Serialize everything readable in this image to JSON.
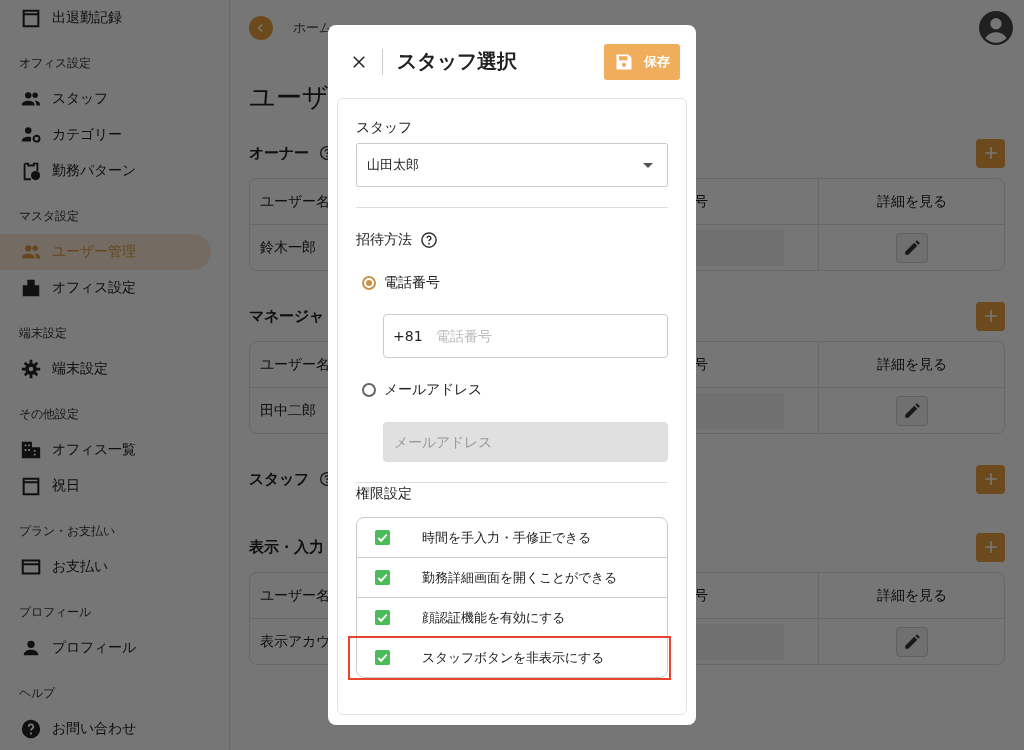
{
  "sidebar": {
    "groups": [
      {
        "items": [
          {
            "label": "出退勤記録",
            "selected": false
          }
        ]
      },
      {
        "heading": "オフィス設定",
        "items": [
          {
            "label": "スタッフ",
            "selected": false
          },
          {
            "label": "カテゴリー",
            "selected": false
          },
          {
            "label": "勤務パターン",
            "selected": false
          }
        ]
      },
      {
        "heading": "マスタ設定",
        "items": [
          {
            "label": "ユーザー管理",
            "selected": true
          },
          {
            "label": "オフィス設定",
            "selected": false
          }
        ]
      },
      {
        "heading": "端末設定",
        "items": [
          {
            "label": "端末設定",
            "selected": false
          }
        ]
      },
      {
        "heading": "その他設定",
        "items": [
          {
            "label": "オフィス一覧",
            "selected": false
          },
          {
            "label": "祝日",
            "selected": false
          }
        ]
      },
      {
        "heading": "プラン・お支払い",
        "items": [
          {
            "label": "お支払い",
            "selected": false
          }
        ]
      },
      {
        "heading": "プロフィール",
        "items": [
          {
            "label": "プロフィール",
            "selected": false
          }
        ]
      },
      {
        "heading": "ヘルプ",
        "items": [
          {
            "label": "お問い合わせ",
            "selected": false
          }
        ]
      }
    ]
  },
  "header": {
    "breadcrumb": "ホーム"
  },
  "page": {
    "title": "ユーザ",
    "sections": [
      {
        "title": "オーナー",
        "help": true,
        "table": {
          "columns": [
            "ユーザー名",
            "号",
            "詳細を見る"
          ],
          "rows": [
            {
              "name": "鈴木一郎"
            }
          ]
        }
      },
      {
        "title": "マネージャ",
        "table": {
          "columns": [
            "ユーザー名",
            "号",
            "詳細を見る"
          ],
          "rows": [
            {
              "name": "田中二郎"
            }
          ]
        }
      },
      {
        "title": "スタッフ",
        "help": true
      },
      {
        "title": "表示・入力",
        "table": {
          "columns": [
            "ユーザー名",
            "号",
            "詳細を見る"
          ],
          "rows": [
            {
              "name": "表示アカウ"
            }
          ]
        }
      }
    ]
  },
  "modal": {
    "title": "スタッフ選択",
    "save_label": "保存",
    "staff": {
      "label": "スタッフ",
      "value": "山田太郎"
    },
    "invite": {
      "label": "招待方法",
      "options": [
        {
          "label": "電話番号",
          "selected": true,
          "field": {
            "prefix": "+81",
            "placeholder": "電話番号",
            "disabled": false
          }
        },
        {
          "label": "メールアドレス",
          "selected": false,
          "field": {
            "placeholder": "メールアドレス",
            "disabled": true
          }
        }
      ]
    },
    "permissions": {
      "label": "権限設定",
      "items": [
        {
          "label": "時間を手入力・手修正できる",
          "checked": true,
          "highlighted": false
        },
        {
          "label": "勤務詳細画面を開くことができる",
          "checked": true,
          "highlighted": false
        },
        {
          "label": "顔認証機能を有効にする",
          "checked": true,
          "highlighted": false
        },
        {
          "label": "スタッフボタンを非表示にする",
          "checked": true,
          "highlighted": true
        }
      ]
    }
  }
}
